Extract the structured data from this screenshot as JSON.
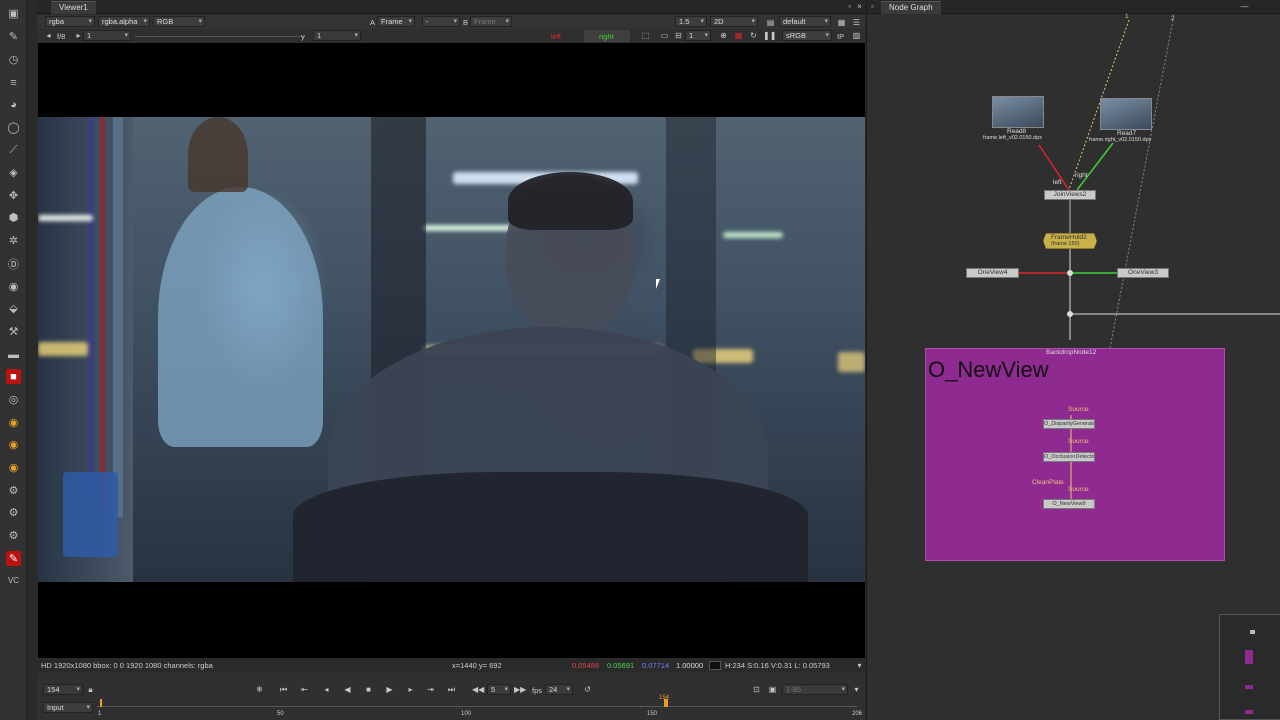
{
  "viewer": {
    "tab_title": "Viewer1",
    "channels": "rgba",
    "alpha_channel": "rgba.alpha",
    "colorspace_rgb": "RGB",
    "a_label": "A",
    "a_input": "Frame",
    "a_op": "-",
    "b_label": "B",
    "b_input": "Frame",
    "gain_display": "1.5",
    "view_mode": "2D",
    "lut": "default",
    "fstop": "f/8",
    "gain_value": "1",
    "y_label": "y",
    "gamma_value": "1",
    "view_left": "left",
    "view_right": "right",
    "proxy_value": "1",
    "display_lut": "sRGB",
    "ip_label": "IP",
    "info_format": "HD 1920x1080 bbox: 0 0 1920 1080 channels: rgba",
    "info_coords": "x=1440 y= 692",
    "info_r": "0.05486",
    "info_g": "0.05691",
    "info_b": "0.07714",
    "info_a": "1.00000",
    "info_hsvl": "H:234 S:0.16 V:0.31  L: 0.05793"
  },
  "timeline": {
    "current_frame": "154",
    "input_label": "Input",
    "step_value": "5",
    "fps_label": "fps",
    "fps_value": "24",
    "range_value": "1-85",
    "ticks": [
      "1",
      "50",
      "100",
      "150",
      "206"
    ],
    "marker": "154"
  },
  "nodegraph": {
    "tab_title": "Node Graph",
    "pipe_1": "1",
    "pipe_2": "2",
    "read8": "Read8",
    "read8_file": "frame.left_v02.0150.dpx",
    "read7": "Read7",
    "read7_file": "frame.right_v02.0150.dpx",
    "left_label": "left",
    "right_label": "right",
    "joinviews": "JoinViews2",
    "framehold": "FrameHold2",
    "framehold_sub": "(frame 150)",
    "oneview4": "OneView4",
    "oneview3": "OneView3",
    "backdrop_name": "BackdropNode12",
    "backdrop_title": "O_NewView",
    "source1": "Source",
    "disparity": "O_DisparityGenerator",
    "source2": "Source",
    "occlusion": "O_OcclusionDetector",
    "cleanplate": "CleanPlate",
    "source3": "Source",
    "newview": "O_NewView9"
  },
  "colors": {
    "accent_red": "#e0242a",
    "accent_green": "#3ad23a",
    "backdrop": "#8f2a91",
    "framehold": "#c9b14a"
  }
}
